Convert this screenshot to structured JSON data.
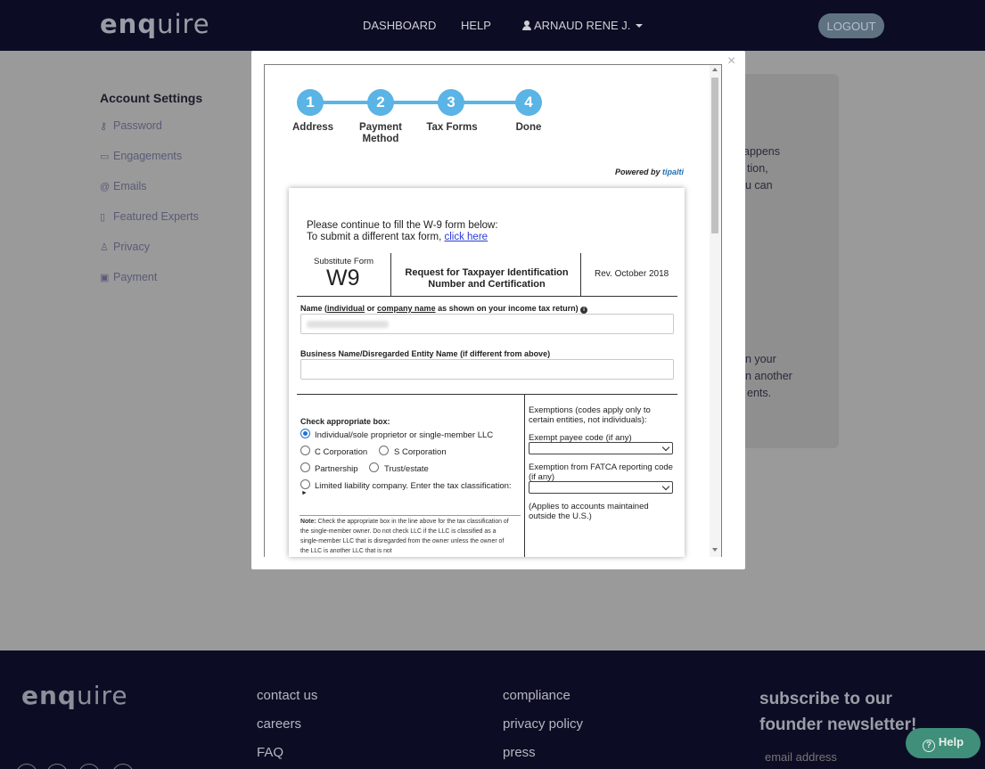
{
  "header": {
    "logo_bold": "enq",
    "logo_light": "uire",
    "nav": [
      "DASHBOARD",
      "HELP"
    ],
    "user_name": "ARNAUD RENE J.",
    "logout_label": "LOGOUT"
  },
  "sidebar": {
    "title": "Account Settings",
    "items": [
      {
        "label": "Password",
        "icon": "key-icon"
      },
      {
        "label": "Engagements",
        "icon": "briefcase-icon"
      },
      {
        "label": "Emails",
        "icon": "at-icon"
      },
      {
        "label": "Featured Experts",
        "icon": "badge-icon"
      },
      {
        "label": "Privacy",
        "icon": "users-lock-icon"
      },
      {
        "label": "Payment",
        "icon": "money-icon"
      }
    ]
  },
  "background_text": [
    "appens",
    "tion,",
    "u can",
    "n your",
    "n another",
    "ents."
  ],
  "modal": {
    "close_label": "×",
    "steps": [
      {
        "number": "1",
        "label": "Address"
      },
      {
        "number": "2",
        "label": "Payment Method"
      },
      {
        "number": "3",
        "label": "Tax Forms"
      },
      {
        "number": "4",
        "label": "Done"
      }
    ],
    "powered_by": "Powered by",
    "powered_brand": "tipalti",
    "intro_line1": "Please continue to fill the W-9 form below:",
    "intro_line2": "To submit a different tax form,",
    "intro_link": "click here",
    "form_sub": "Substitute Form",
    "form_code": "W9",
    "form_title": "Request for Taxpayer Identification Number and Certification",
    "form_rev": "Rev. October 2018",
    "name_label_pre": "Name (",
    "name_label_u1": "individual",
    "name_label_or": " or ",
    "name_label_u2": "company name",
    "name_label_post": " as shown on your income tax return)",
    "name_value": "ARNAUD R JASPAR",
    "business_label": "Business Name/Disregarded Entity Name (if different from above)",
    "business_value": "",
    "check_box_label": "Check appropriate box:",
    "radios": {
      "individual": "Individual/sole proprietor or single-member LLC",
      "c_corp": "C Corporation",
      "s_corp": "S Corporation",
      "partnership": "Partnership",
      "trust": "Trust/estate",
      "llc": "Limited liability company. Enter the tax classification:",
      "llc_arrow": "►"
    },
    "note_bold": "Note:",
    "note_text": " Check the appropriate box in the line above for the tax classification of the single-member owner. Do not check LLC if the LLC is classified as a single-member LLC that is disregarded from the owner unless the owner of the LLC is another LLC that is not",
    "exemptions_label": "Exemptions (codes apply only to certain entities, not individuals):",
    "exempt_payee_label": "Exempt payee code (if any)",
    "fatca_label": "Exemption from FATCA reporting code (if any)",
    "fatca_note": "(Applies to accounts maintained outside the U.S.)"
  },
  "footer": {
    "logo_bold": "enq",
    "logo_light": "uire",
    "col1": [
      "contact us",
      "careers",
      "FAQ"
    ],
    "col2": [
      "compliance",
      "privacy policy",
      "press"
    ],
    "newsletter_title": "subscribe to our founder newsletter!",
    "email_placeholder": "email address",
    "help_label": "Help"
  },
  "colors": {
    "nav_bg": "#0c0d24",
    "step_blue": "#5ab4e5",
    "help_green": "#3f8f7a",
    "overlay_bg": "#9a9a9a"
  }
}
